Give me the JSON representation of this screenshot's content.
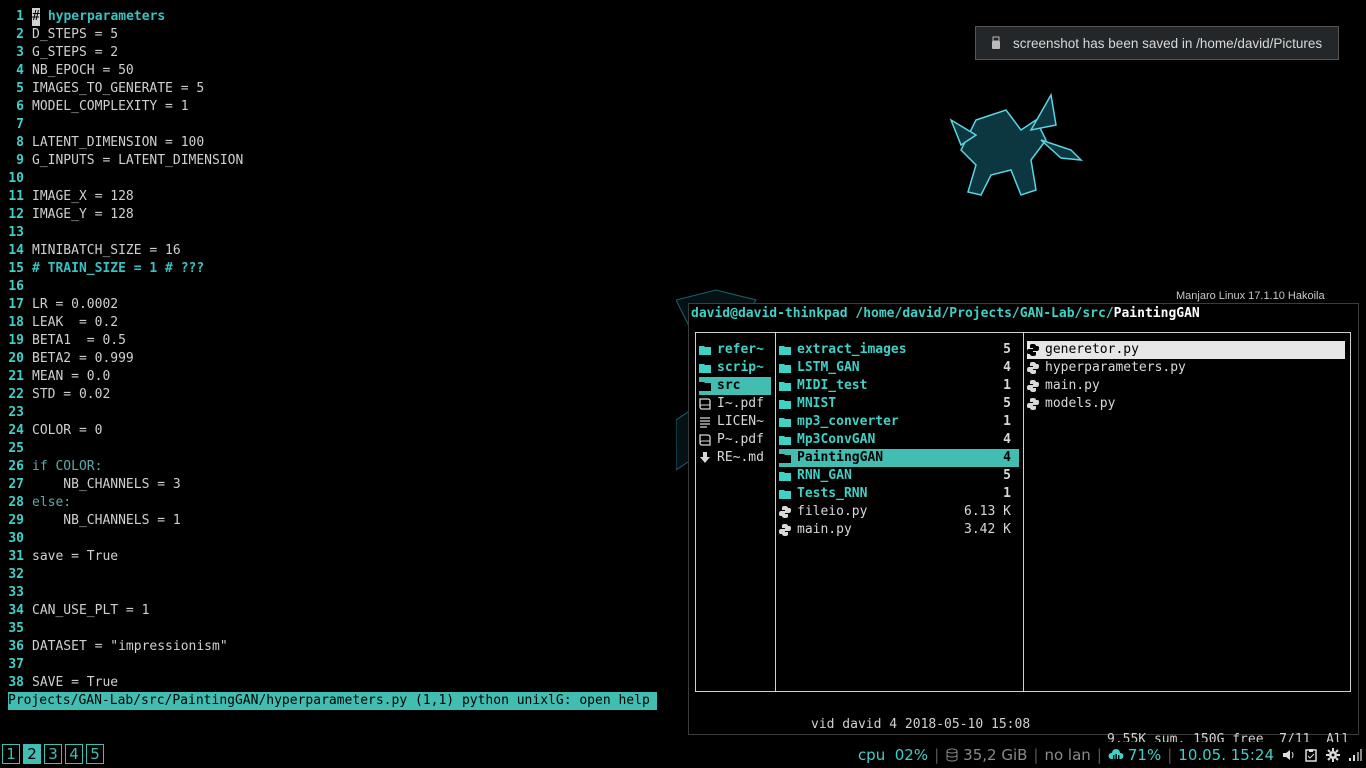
{
  "notification": {
    "icon": "usb-drive-icon",
    "text": "screenshot has been saved in /home/david/Pictures"
  },
  "wallpaper": {
    "distro_label": "Manjaro Linux 17.1.10 Hakoila"
  },
  "editor": {
    "lines": [
      {
        "n": "1",
        "text": "hyperparameters",
        "type": "comment-cursor"
      },
      {
        "n": "2",
        "text": "D_STEPS = 5"
      },
      {
        "n": "3",
        "text": "G_STEPS = 2"
      },
      {
        "n": "4",
        "text": "NB_EPOCH = 50"
      },
      {
        "n": "5",
        "text": "IMAGES_TO_GENERATE = 5"
      },
      {
        "n": "6",
        "text": "MODEL_COMPLEXITY = 1"
      },
      {
        "n": "7",
        "text": ""
      },
      {
        "n": "8",
        "text": "LATENT_DIMENSION = 100"
      },
      {
        "n": "9",
        "text": "G_INPUTS = LATENT_DIMENSION"
      },
      {
        "n": "10",
        "text": ""
      },
      {
        "n": "11",
        "text": "IMAGE_X = 128"
      },
      {
        "n": "12",
        "text": "IMAGE_Y = 128"
      },
      {
        "n": "13",
        "text": ""
      },
      {
        "n": "14",
        "text": "MINIBATCH_SIZE = 16"
      },
      {
        "n": "15",
        "text": "# TRAIN_SIZE = 1 # ???",
        "type": "comment"
      },
      {
        "n": "16",
        "text": ""
      },
      {
        "n": "17",
        "text": "LR = 0.0002"
      },
      {
        "n": "18",
        "text": "LEAK  = 0.2"
      },
      {
        "n": "19",
        "text": "BETA1  = 0.5"
      },
      {
        "n": "20",
        "text": "BETA2 = 0.999"
      },
      {
        "n": "21",
        "text": "MEAN = 0.0"
      },
      {
        "n": "22",
        "text": "STD = 0.02"
      },
      {
        "n": "23",
        "text": ""
      },
      {
        "n": "24",
        "text": "COLOR = 0"
      },
      {
        "n": "25",
        "text": ""
      },
      {
        "n": "26",
        "text": "if COLOR:",
        "type": "keyword"
      },
      {
        "n": "27",
        "text": "    NB_CHANNELS = 3"
      },
      {
        "n": "28",
        "text": "else:",
        "type": "keyword"
      },
      {
        "n": "29",
        "text": "    NB_CHANNELS = 1"
      },
      {
        "n": "30",
        "text": ""
      },
      {
        "n": "31",
        "text": "save = True"
      },
      {
        "n": "32",
        "text": ""
      },
      {
        "n": "33",
        "text": ""
      },
      {
        "n": "34",
        "text": "CAN_USE_PLT = 1"
      },
      {
        "n": "35",
        "text": ""
      },
      {
        "n": "36",
        "text": "DATASET = \"impressionism\""
      },
      {
        "n": "37",
        "text": ""
      },
      {
        "n": "38",
        "text": "SAVE = True"
      }
    ],
    "cursor_char": "#",
    "status_line": "Projects/GAN-Lab/src/PaintingGAN/hyperparameters.py (1,1) python unixlG: open help"
  },
  "ranger": {
    "user_host": "david@david-thinkpad",
    "path": "/home/david/Projects/GAN-Lab/src/",
    "current": "PaintingGAN",
    "parent": [
      {
        "name": "refer~",
        "type": "dir",
        "icon": "folder-icon"
      },
      {
        "name": "scrip~",
        "type": "dir",
        "icon": "folder-icon"
      },
      {
        "name": "src",
        "type": "dir",
        "icon": "folder-icon",
        "selected": true
      },
      {
        "name": "I~.pdf",
        "type": "file",
        "icon": "book-icon"
      },
      {
        "name": "LICEN~",
        "type": "file",
        "icon": "text-file-icon"
      },
      {
        "name": "P~.pdf",
        "type": "file",
        "icon": "book-icon"
      },
      {
        "name": "RE~.md",
        "type": "file",
        "icon": "download-icon"
      }
    ],
    "current_dir": [
      {
        "name": "extract_images",
        "type": "dir",
        "count": "5",
        "icon": "folder-icon"
      },
      {
        "name": "LSTM_GAN",
        "type": "dir",
        "count": "4",
        "icon": "folder-icon"
      },
      {
        "name": "MIDI_test",
        "type": "dir",
        "count": "1",
        "icon": "folder-icon"
      },
      {
        "name": "MNIST",
        "type": "dir",
        "count": "5",
        "icon": "folder-icon"
      },
      {
        "name": "mp3_converter",
        "type": "dir",
        "count": "1",
        "icon": "folder-icon"
      },
      {
        "name": "Mp3ConvGAN",
        "type": "dir",
        "count": "4",
        "icon": "folder-icon"
      },
      {
        "name": "PaintingGAN",
        "type": "dir",
        "count": "4",
        "icon": "folder-icon",
        "selected": true
      },
      {
        "name": "RNN_GAN",
        "type": "dir",
        "count": "5",
        "icon": "folder-icon"
      },
      {
        "name": "Tests_RNN",
        "type": "dir",
        "count": "1",
        "icon": "folder-icon"
      },
      {
        "name": "fileio.py",
        "type": "file",
        "count": "6.13 K",
        "icon": "python-icon"
      },
      {
        "name": "main.py",
        "type": "file",
        "count": "3.42 K",
        "icon": "python-icon"
      }
    ],
    "preview": [
      {
        "name": "generetor.py",
        "type": "file",
        "icon": "python-icon",
        "selected": true
      },
      {
        "name": "hyperparameters.py",
        "type": "file",
        "icon": "python-icon"
      },
      {
        "name": "main.py",
        "type": "file",
        "icon": "python-icon"
      },
      {
        "name": "models.py",
        "type": "file",
        "icon": "python-icon"
      }
    ],
    "status_left": "vid david 4 2018-05-10 15:08",
    "status_right": "9.55K sum, 150G free  7/11  All"
  },
  "bar": {
    "workspaces": [
      "1",
      "2",
      "3",
      "4",
      "5"
    ],
    "active_workspace": "2",
    "cpu_label": "cpu",
    "cpu_value": "02%",
    "disk": "35,2 GiB",
    "lan": "no lan",
    "battery": "71%",
    "datetime": "10.05. 15:24",
    "tray_icons": [
      "volume-icon",
      "clipboard-icon",
      "settings-icon",
      "signal-icon"
    ],
    "colors": {
      "accent": "#41bdb2",
      "text": "#3fd0c6"
    }
  }
}
